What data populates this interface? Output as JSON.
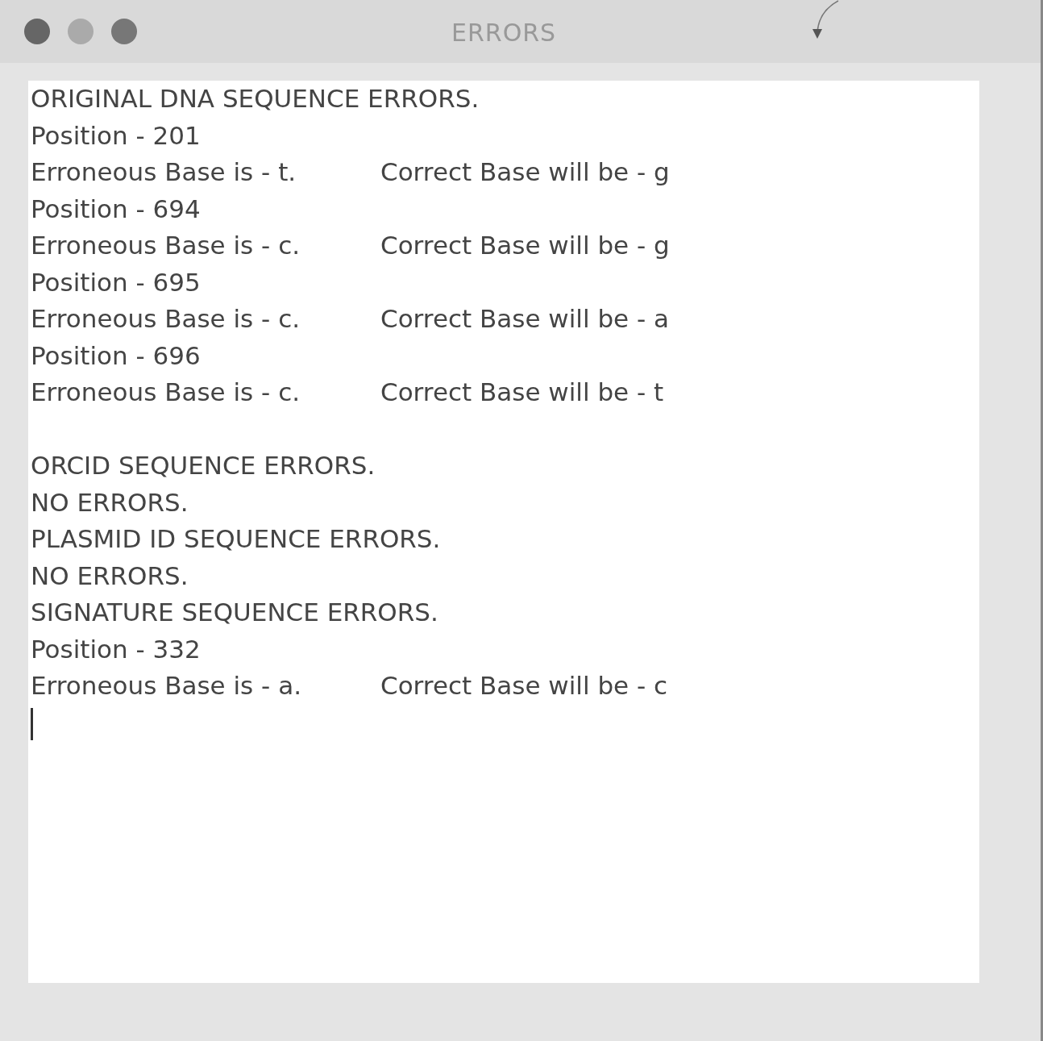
{
  "window": {
    "title": "ERRORS"
  },
  "lines": [
    {
      "kind": "heading",
      "text": "ORIGINAL DNA SEQUENCE ERRORS."
    },
    {
      "kind": "text",
      "text": "Position - 201"
    },
    {
      "kind": "error",
      "erroneous": "Erroneous Base is - t.",
      "correct": "Correct Base will be - g"
    },
    {
      "kind": "text",
      "text": "Position - 694"
    },
    {
      "kind": "error",
      "erroneous": "Erroneous Base is - c.",
      "correct": "Correct Base will be - g"
    },
    {
      "kind": "text",
      "text": "Position - 695"
    },
    {
      "kind": "error",
      "erroneous": "Erroneous Base is - c.",
      "correct": "Correct Base will be - a"
    },
    {
      "kind": "text",
      "text": "Position - 696"
    },
    {
      "kind": "error",
      "erroneous": "Erroneous Base is - c.",
      "correct": "Correct Base will be - t"
    },
    {
      "kind": "blank"
    },
    {
      "kind": "heading",
      "text": "ORCID SEQUENCE ERRORS."
    },
    {
      "kind": "text",
      "text": "NO ERRORS."
    },
    {
      "kind": "heading",
      "text": "PLASMID ID SEQUENCE ERRORS."
    },
    {
      "kind": "text",
      "text": "NO ERRORS."
    },
    {
      "kind": "heading",
      "text": "SIGNATURE SEQUENCE ERRORS."
    },
    {
      "kind": "text",
      "text": "Position - 332"
    },
    {
      "kind": "error",
      "erroneous": "Erroneous Base is - a.",
      "correct": "Correct Base will be - c"
    },
    {
      "kind": "cursor"
    }
  ]
}
